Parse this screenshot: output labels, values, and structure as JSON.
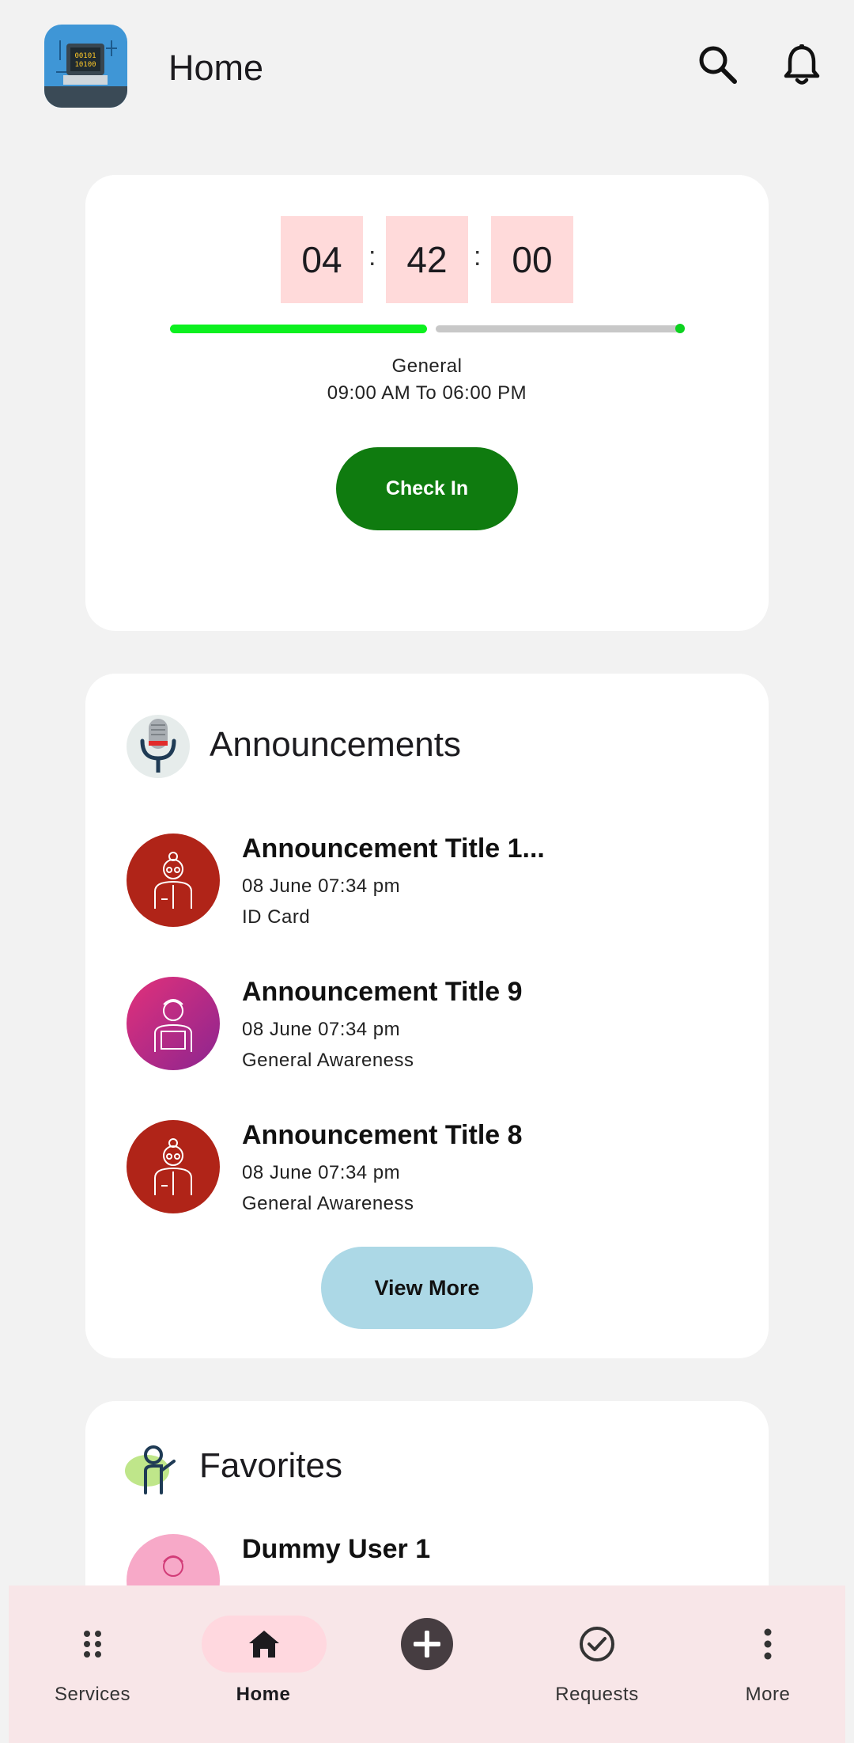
{
  "header": {
    "title": "Home",
    "logo_icon": "binary-computer-logo-icon",
    "search_icon": "search-icon",
    "bell_icon": "bell-icon"
  },
  "attendance": {
    "hours": "04",
    "minutes": "42",
    "seconds": "00",
    "separator": ":",
    "progress_fraction": 0.51,
    "shift_name": "General",
    "shift_time": "09:00 AM To 06:00 PM",
    "check_in_label": "Check In",
    "colors": {
      "done": "#0cf01f",
      "remaining": "#c8c8c8",
      "button": "#0f7b0f",
      "time_box": "#ffdada"
    }
  },
  "announcements": {
    "title": "Announcements",
    "icon": "microphone-icon",
    "items": [
      {
        "title": "Announcement Title 1...",
        "date": "08 June 07:34 pm",
        "category": "ID Card",
        "avatar_icon": "woman-avatar-icon",
        "avatar_color": "#b02418"
      },
      {
        "title": "Announcement Title 9",
        "date": "08 June 07:34 pm",
        "category": "General Awareness",
        "avatar_icon": "man-avatar-icon",
        "avatar_color": "#c3297f"
      },
      {
        "title": "Announcement Title 8",
        "date": "08 June 07:34 pm",
        "category": "General Awareness",
        "avatar_icon": "woman-avatar-icon",
        "avatar_color": "#b02418"
      }
    ],
    "view_more_label": "View More"
  },
  "favorites": {
    "title": "Favorites",
    "icon": "waving-person-icon",
    "items": [
      {
        "name": "Dummy User 1",
        "avatar_icon": "user-avatar-icon",
        "avatar_color": "#f7a9c8"
      }
    ]
  },
  "bottom_nav": {
    "items": [
      {
        "label": "Services",
        "icon": "grid-dots-icon"
      },
      {
        "label": "Home",
        "icon": "home-icon",
        "active": true
      },
      {
        "label": "",
        "icon": "add-circle-icon"
      },
      {
        "label": "Requests",
        "icon": "check-circle-icon"
      },
      {
        "label": "More",
        "icon": "more-vertical-icon"
      }
    ]
  }
}
